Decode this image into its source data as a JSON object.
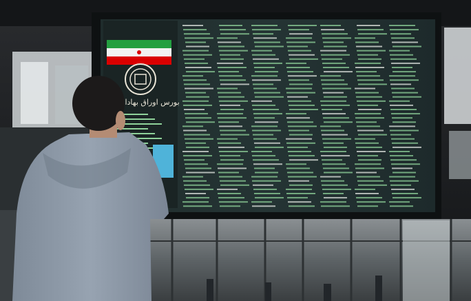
{
  "scene": {
    "description_colors": {
      "board_bg": "#1c2a2a",
      "board_text": "#9fd3a8",
      "flag_green": "#239f40",
      "flag_white": "#f2f2f2",
      "flag_red": "#da0000",
      "hoodie": "#8d99a8"
    }
  },
  "board": {
    "logo_caption": "بورس اوراق بهادار تهران"
  }
}
